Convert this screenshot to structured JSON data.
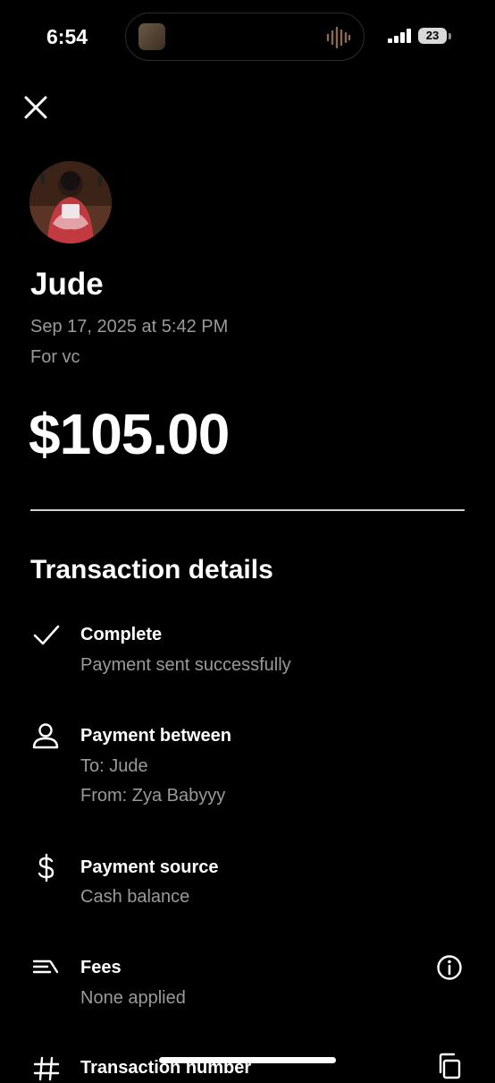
{
  "status_bar": {
    "time": "6:54",
    "battery": "23"
  },
  "header": {
    "close_icon": "close-icon"
  },
  "payee": {
    "name": "Jude",
    "date": "Sep 17, 2025 at 5:42 PM",
    "note": "For vc"
  },
  "amount": "$105.00",
  "details": {
    "title": "Transaction details",
    "status": {
      "icon": "check-icon",
      "title": "Complete",
      "subtitle": "Payment sent successfully"
    },
    "between": {
      "icon": "person-icon",
      "title": "Payment between",
      "to": "To: Jude",
      "from": "From: Zya Babyyy"
    },
    "source": {
      "icon": "dollar-icon",
      "title": "Payment source",
      "subtitle": "Cash balance"
    },
    "fees": {
      "icon": "fees-icon",
      "title": "Fees",
      "subtitle": "None applied"
    },
    "transaction_number": {
      "icon": "hash-icon",
      "title": "Transaction number"
    }
  },
  "colors": {
    "background": "#000000",
    "text": "#ffffff",
    "secondary_text": "#9a9a9a"
  }
}
